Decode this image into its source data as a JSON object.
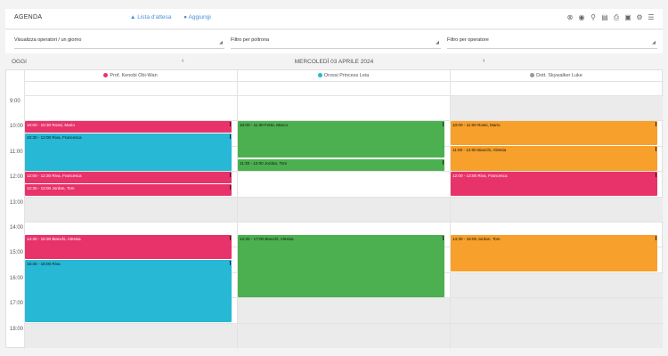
{
  "header": {
    "title": "AGENDA",
    "link_waitlist": "Lista d'attesa",
    "link_add": "Aggiungi",
    "toolbar_icons": [
      "close-circle-icon",
      "eye-icon",
      "search-icon",
      "calendar-icon",
      "print-icon",
      "car-icon",
      "settings-icon",
      "sliders-icon"
    ]
  },
  "filters": {
    "view": "Visualizza operatori / un giorno",
    "chair": "Filtro per poltrona",
    "operator": "Filtro per operatore"
  },
  "nav": {
    "today": "OGGI",
    "date": "MERCOLEDÌ 03  APRILE 2024",
    "prev": "‹",
    "next": "›"
  },
  "columns": [
    {
      "name": "Prof. Kenobi Obi-Wan",
      "color": "#e8326a"
    },
    {
      "name": "Orossi Princess Leia",
      "color": "#26b8d4"
    },
    {
      "name": "Dott. Skywalker Luke",
      "color": "#999999"
    }
  ],
  "times": [
    "9:00",
    "10:00",
    "11:00",
    "12:00",
    "13:00",
    "14:00",
    "15:00",
    "16:00",
    "17:00",
    "18:00"
  ],
  "events": [
    {
      "col": 0,
      "start": 10.0,
      "end": 10.5,
      "color": "pink",
      "label": "10:00 - 10:30 Rossi, Mario"
    },
    {
      "col": 0,
      "start": 10.5,
      "end": 12.0,
      "color": "cyan",
      "label": "10:30 - 12:00 Riva, Francesca"
    },
    {
      "col": 0,
      "start": 12.0,
      "end": 12.5,
      "color": "pink",
      "label": "12:00 - 12:30 Riva, Francesca"
    },
    {
      "col": 0,
      "start": 12.5,
      "end": 13.0,
      "color": "pink",
      "label": "12:30 - 13:00 Jordan, Tom"
    },
    {
      "col": 0,
      "start": 14.5,
      "end": 15.5,
      "color": "pink",
      "label": "14:30 - 15:30 Bianchi, Alessia"
    },
    {
      "col": 0,
      "start": 15.5,
      "end": 18.0,
      "color": "cyan",
      "label": "15:30 - 18:00 Riva"
    },
    {
      "col": 1,
      "start": 10.0,
      "end": 11.5,
      "color": "green",
      "label": "10:00 - 11:30 Forte, Marco"
    },
    {
      "col": 1,
      "start": 11.5,
      "end": 12.0,
      "color": "green",
      "label": "11:30 - 12:00 Jordan, Tom"
    },
    {
      "col": 1,
      "start": 14.5,
      "end": 17.0,
      "color": "green",
      "label": "14:30 - 17:00 Bianchi, Alessia"
    },
    {
      "col": 2,
      "start": 10.0,
      "end": 11.0,
      "color": "orange",
      "label": "10:00 - 11:00 Rossi, Mario"
    },
    {
      "col": 2,
      "start": 11.0,
      "end": 12.0,
      "color": "orange",
      "label": "11:00 - 12:00 Bianchi, Alessia"
    },
    {
      "col": 2,
      "start": 12.0,
      "end": 13.0,
      "color": "pink",
      "label": "12:00 - 13:00 Riva, Francesca"
    },
    {
      "col": 2,
      "start": 14.5,
      "end": 16.0,
      "color": "orange",
      "label": "14:30 - 16:00 Jordan, Tom"
    }
  ]
}
